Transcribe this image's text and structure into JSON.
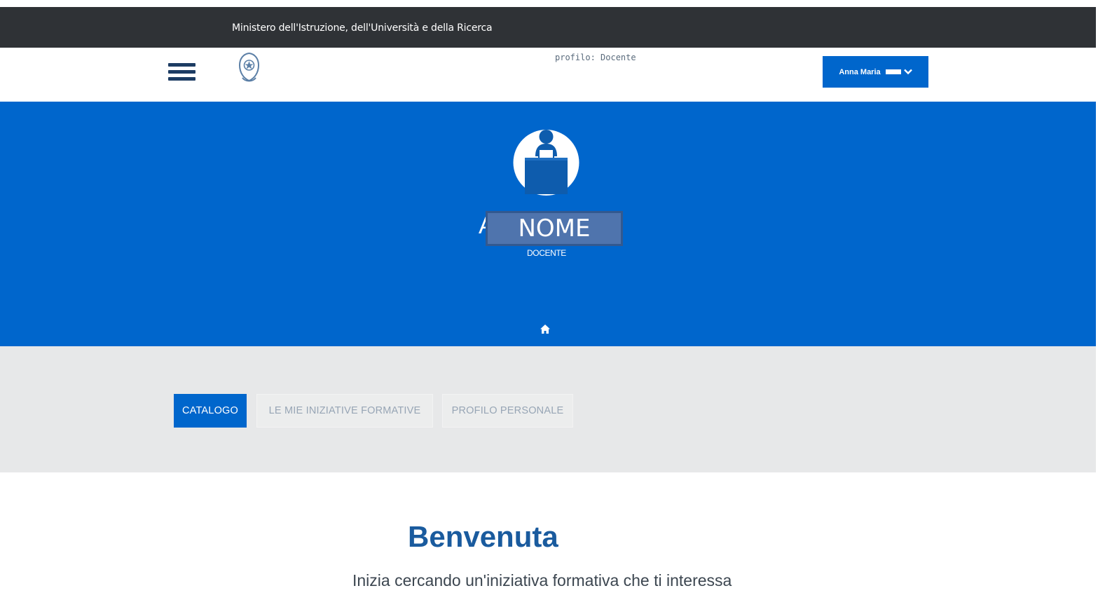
{
  "topbar": {
    "ministry": "Ministero dell'Istruzione, dell'Università e della Ricerca"
  },
  "header": {
    "profile_label": "profilo: Docente",
    "user_button": "Anna Maria"
  },
  "hero": {
    "name_fragment": "A",
    "name_placeholder": "NOME",
    "role": "DOCENTE"
  },
  "tabs": [
    {
      "label": "CATALOGO",
      "active": true
    },
    {
      "label": "LE MIE INIZIATIVE FORMATIVE",
      "active": false
    },
    {
      "label": "PROFILO PERSONALE",
      "active": false
    }
  ],
  "main": {
    "welcome": "Benvenuta",
    "lead": "Inizia cercando un'iniziativa formativa che ti interessa"
  },
  "colors": {
    "brand_blue": "#0066cc",
    "topbar": "#2f3236",
    "tabs_band": "#e7e8e9"
  },
  "icons": [
    "hamburger-menu-icon",
    "republic-emblem-icon",
    "chevron-down-icon",
    "teacher-avatar-icon",
    "home-icon"
  ]
}
